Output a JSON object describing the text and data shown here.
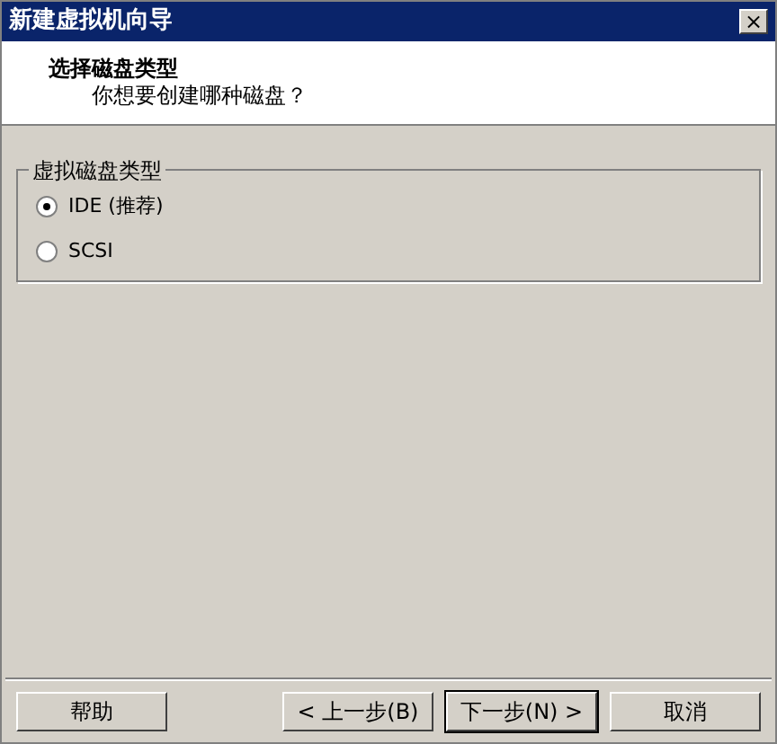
{
  "window": {
    "title": "新建虚拟机向导",
    "close": "×"
  },
  "header": {
    "title": "选择磁盘类型",
    "subtitle": "你想要创建哪种磁盘？"
  },
  "group": {
    "label": "虚拟磁盘类型",
    "options": [
      {
        "label": "IDE (推荐)",
        "selected": true
      },
      {
        "label": "SCSI",
        "selected": false
      }
    ]
  },
  "buttons": [
    {
      "label": "帮助",
      "kind": "left",
      "default": false
    },
    {
      "label": "< 上一步(B)",
      "kind": "right",
      "default": false
    },
    {
      "label": "下一步(N) >",
      "kind": "right",
      "default": true
    },
    {
      "label": "取消",
      "kind": "right",
      "default": false
    }
  ]
}
